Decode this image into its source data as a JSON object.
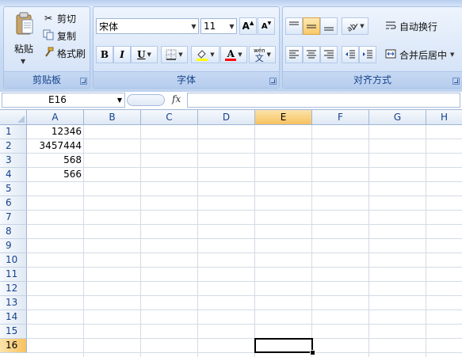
{
  "clipboard": {
    "paste_label": "粘贴",
    "cut_label": "剪切",
    "copy_label": "复制",
    "format_painter_label": "格式刷",
    "group_label": "剪贴板"
  },
  "font": {
    "family": "宋体",
    "size": "11",
    "bold": "B",
    "italic": "I",
    "underline": "U",
    "grow": "A",
    "shrink": "A",
    "font_color_glyph": "A",
    "phonetic_top": "wén",
    "phonetic_bottom": "文",
    "group_label": "字体",
    "fill_color": "#ffff00",
    "font_color": "#ff0000"
  },
  "alignment": {
    "wrap_label": "自动换行",
    "merge_label": "合并后居中",
    "group_label": "对齐方式"
  },
  "formula_bar": {
    "name_box": "E16",
    "fx": "fx",
    "formula": ""
  },
  "columns": [
    "A",
    "B",
    "C",
    "D",
    "E",
    "F",
    "G",
    "H"
  ],
  "selected_column": "E",
  "rows": [
    "1",
    "2",
    "3",
    "4",
    "5",
    "6",
    "7",
    "8",
    "9",
    "10",
    "11",
    "12",
    "13",
    "14",
    "15",
    "16"
  ],
  "selected_row": "16",
  "cells": {
    "A1": "12346",
    "A2": "3457444",
    "A3": "568",
    "A4": "566"
  },
  "colors": {
    "accent": "#15428b",
    "selection_header": "#f7c261"
  }
}
